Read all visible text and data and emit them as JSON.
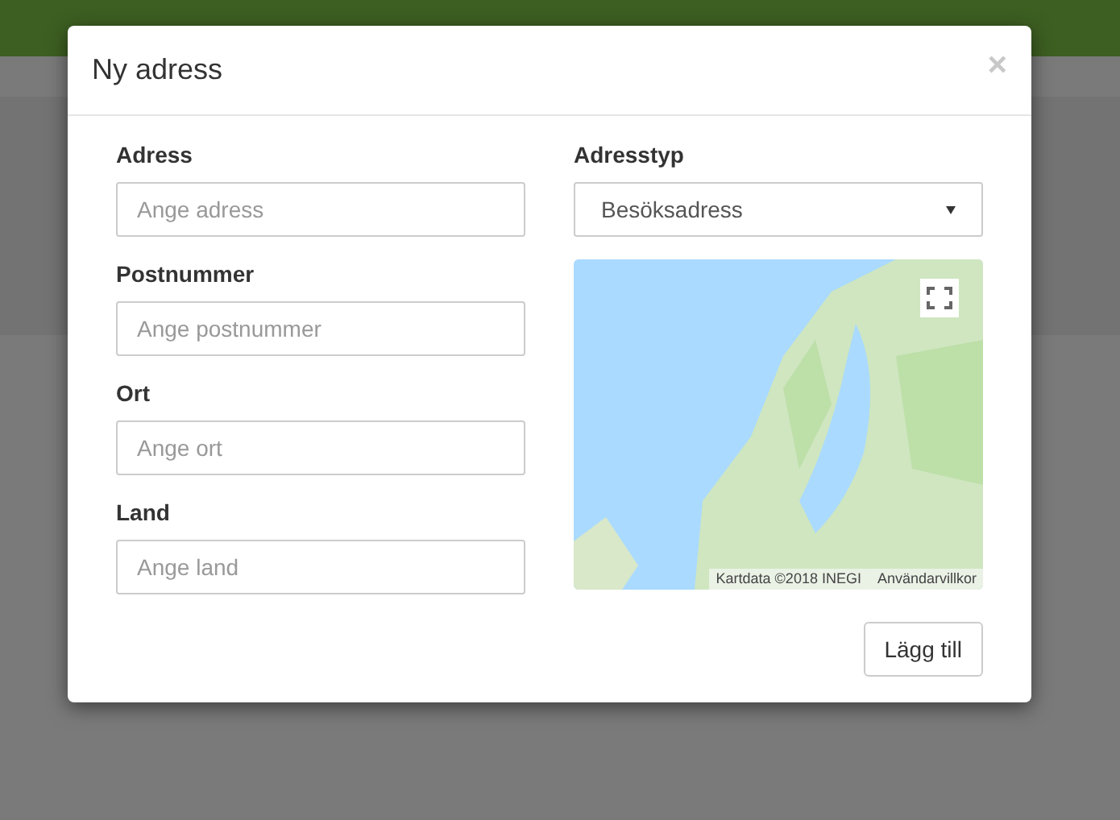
{
  "dialog": {
    "title": "Ny adress",
    "close": "×",
    "fields": [
      {
        "label": "Adress",
        "placeholder": "Ange adress"
      },
      {
        "label": "Postnummer",
        "placeholder": "Ange postnummer"
      },
      {
        "label": "Ort",
        "placeholder": "Ange ort"
      },
      {
        "label": "Land",
        "placeholder": "Ange land"
      }
    ],
    "address_type": {
      "label": "Adresstyp",
      "value": "Besöksadress"
    },
    "map": {
      "kind": "picture",
      "attribution": "Kartdata ©2018 INEGI",
      "terms": "Användarvillkor"
    },
    "submit": "Lägg till"
  }
}
